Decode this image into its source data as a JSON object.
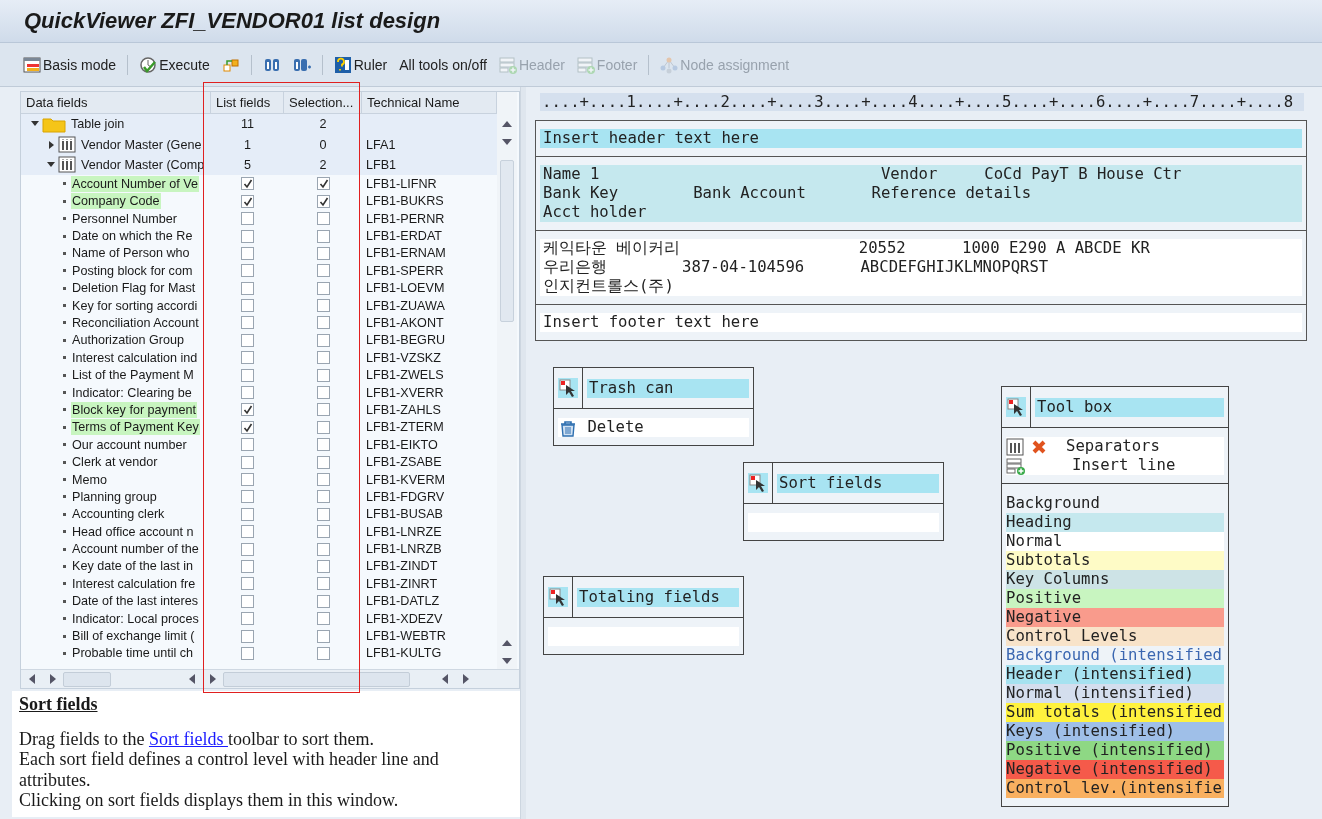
{
  "window": {
    "title": "QuickViewer ZFI_VENDOR01 list design"
  },
  "toolbar": [
    {
      "kind": "button",
      "label": "Basis mode",
      "disabled": false
    },
    {
      "kind": "separator"
    },
    {
      "kind": "button",
      "label": "Execute",
      "disabled": false
    },
    {
      "kind": "button",
      "disabled": false
    },
    {
      "kind": "separator"
    },
    {
      "kind": "button",
      "disabled": false
    },
    {
      "kind": "button",
      "disabled": false
    },
    {
      "kind": "separator"
    },
    {
      "kind": "button",
      "label": "Ruler",
      "disabled": false
    },
    {
      "kind": "button",
      "label": "All tools on/off",
      "disabled": false
    },
    {
      "kind": "button",
      "label": "Header",
      "disabled": true
    },
    {
      "kind": "button",
      "label": "Footer",
      "disabled": true
    },
    {
      "kind": "separator"
    },
    {
      "kind": "button",
      "label": "Node assignment",
      "disabled": true
    }
  ],
  "tree": {
    "columns": [
      "Data fields",
      "List fields",
      "Selection...",
      "Technical Name"
    ],
    "root": {
      "label": "Table join",
      "list_count": "11",
      "selection_count": "2",
      "expanded": true,
      "children": [
        {
          "label": "Vendor Master (Gene",
          "list_count": "1",
          "selection_count": "0",
          "technical_name": "LFA1",
          "expanded": false
        },
        {
          "label": "Vendor Master (Comp",
          "list_count": "5",
          "selection_count": "2",
          "technical_name": "LFB1",
          "expanded": true,
          "children": [
            {
              "label": "Account Number of Ve",
              "list_field": true,
              "selection_field": true,
              "technical_name": "LFB1-LIFNR"
            },
            {
              "label": "Company Code",
              "list_field": true,
              "selection_field": true,
              "technical_name": "LFB1-BUKRS"
            },
            {
              "label": "Personnel Number",
              "list_field": false,
              "selection_field": false,
              "technical_name": "LFB1-PERNR"
            },
            {
              "label": "Date on which the Re",
              "list_field": false,
              "selection_field": false,
              "technical_name": "LFB1-ERDAT"
            },
            {
              "label": "Name of Person who",
              "list_field": false,
              "selection_field": false,
              "technical_name": "LFB1-ERNAM"
            },
            {
              "label": "Posting block for com",
              "list_field": false,
              "selection_field": false,
              "technical_name": "LFB1-SPERR"
            },
            {
              "label": "Deletion Flag for Mast",
              "list_field": false,
              "selection_field": false,
              "technical_name": "LFB1-LOEVM"
            },
            {
              "label": "Key for sorting accordi",
              "list_field": false,
              "selection_field": false,
              "technical_name": "LFB1-ZUAWA"
            },
            {
              "label": "Reconciliation Account",
              "list_field": false,
              "selection_field": false,
              "technical_name": "LFB1-AKONT"
            },
            {
              "label": "Authorization Group",
              "list_field": false,
              "selection_field": false,
              "technical_name": "LFB1-BEGRU"
            },
            {
              "label": "Interest calculation ind",
              "list_field": false,
              "selection_field": false,
              "technical_name": "LFB1-VZSKZ"
            },
            {
              "label": "List of the Payment M",
              "list_field": false,
              "selection_field": false,
              "technical_name": "LFB1-ZWELS"
            },
            {
              "label": "Indicator: Clearing be",
              "list_field": false,
              "selection_field": false,
              "technical_name": "LFB1-XVERR"
            },
            {
              "label": "Block key for payment",
              "list_field": true,
              "selection_field": false,
              "technical_name": "LFB1-ZAHLS"
            },
            {
              "label": "Terms of Payment Key",
              "list_field": true,
              "selection_field": false,
              "technical_name": "LFB1-ZTERM"
            },
            {
              "label": "Our account number",
              "list_field": false,
              "selection_field": false,
              "technical_name": "LFB1-EIKTO"
            },
            {
              "label": "Clerk at vendor",
              "list_field": false,
              "selection_field": false,
              "technical_name": "LFB1-ZSABE"
            },
            {
              "label": "Memo",
              "list_field": false,
              "selection_field": false,
              "technical_name": "LFB1-KVERM"
            },
            {
              "label": "Planning group",
              "list_field": false,
              "selection_field": false,
              "technical_name": "LFB1-FDGRV"
            },
            {
              "label": "Accounting clerk",
              "list_field": false,
              "selection_field": false,
              "technical_name": "LFB1-BUSAB"
            },
            {
              "label": "Head office account n",
              "list_field": false,
              "selection_field": false,
              "technical_name": "LFB1-LNRZE"
            },
            {
              "label": "Account number of the",
              "list_field": false,
              "selection_field": false,
              "technical_name": "LFB1-LNRZB"
            },
            {
              "label": "Key date of the last in",
              "list_field": false,
              "selection_field": false,
              "technical_name": "LFB1-ZINDT"
            },
            {
              "label": "Interest calculation fre",
              "list_field": false,
              "selection_field": false,
              "technical_name": "LFB1-ZINRT"
            },
            {
              "label": "Date of the last interes",
              "list_field": false,
              "selection_field": false,
              "technical_name": "LFB1-DATLZ"
            },
            {
              "label": "Indicator: Local proces",
              "list_field": false,
              "selection_field": false,
              "technical_name": "LFB1-XDEZV"
            },
            {
              "label": "Bill of exchange limit (",
              "list_field": false,
              "selection_field": false,
              "technical_name": "LFB1-WEBTR"
            },
            {
              "label": "Probable time until ch",
              "list_field": false,
              "selection_field": false,
              "technical_name": "LFB1-KULTG"
            }
          ]
        }
      ]
    }
  },
  "help": {
    "heading": "Sort fields",
    "paragraphs": [
      {
        "before": "Drag fields to the ",
        "link": "Sort fields ",
        "after": "toolbar to sort them."
      },
      {
        "text": "Each sort field defines a control level with header line and attributes."
      },
      {
        "text": "Clicking on sort fields displays them in this window."
      }
    ]
  },
  "ruler": "....+....1....+....2....+....3....+....4....+....5....+....6....+....7....+....8",
  "layout": {
    "header": "Insert header text here",
    "headings": [
      "Name 1                              Vendor     CoCd PayT B House Ctr",
      "Bank Key        Bank Account       Reference details",
      "Acct holder"
    ],
    "data": [
      "케익타운 베이커리                   20552      1000 E290 A ABCDE KR",
      "우리은행        387-04-104596      ABCDEFGHIJKLMNOPQRST",
      "인지컨트롤스(주)"
    ],
    "footer": "Insert footer text here"
  },
  "trash_can": {
    "title": "Trash can",
    "item": "Delete"
  },
  "sort_fields": {
    "title": "Sort fields"
  },
  "totaling_fields": {
    "title": "Totaling fields"
  },
  "tool_box": {
    "title": "Tool box",
    "tools": [
      "Separators",
      "Insert line"
    ],
    "colors": [
      {
        "label": "Background",
        "color": "#eef3f8"
      },
      {
        "label": "Heading",
        "color": "#c5e8ee"
      },
      {
        "label": "Normal",
        "color": "#ffffff"
      },
      {
        "label": "Subtotals",
        "color": "#fefbc6"
      },
      {
        "label": "Key Columns",
        "color": "#cde3e6"
      },
      {
        "label": "Positive",
        "color": "#c8f5c0"
      },
      {
        "label": "Negative",
        "color": "#f99b8c"
      },
      {
        "label": "Control Levels",
        "color": "#f8e3c9"
      },
      {
        "label": "Background (intensified",
        "color": "#eef3f8",
        "kind": "intensified_text"
      },
      {
        "label": "Header (intensified)",
        "color": "#a6e2f0"
      },
      {
        "label": "Normal (intensified)",
        "color": "#d4deee"
      },
      {
        "label": "Sum totals (intensified",
        "color": "#fff23e"
      },
      {
        "label": "Keys (intensified)",
        "color": "#9fbfe8"
      },
      {
        "label": "Positive (intensified)",
        "color": "#8ed884"
      },
      {
        "label": "Negative (intensified)",
        "color": "#f55a4a"
      },
      {
        "label": "Control lev.(intensifie",
        "color": "#f9b060"
      }
    ]
  },
  "annotation": {
    "kind": "rectangle"
  }
}
